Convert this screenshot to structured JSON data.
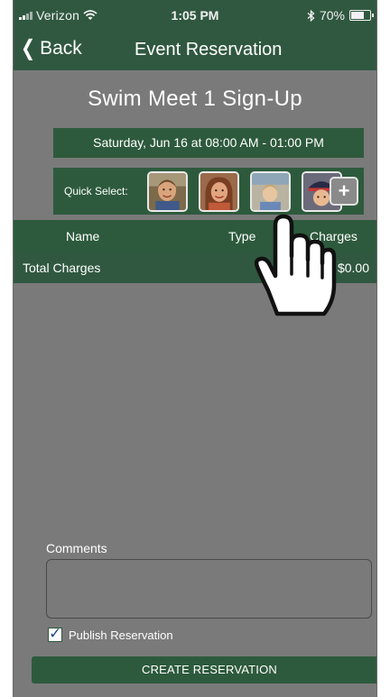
{
  "status_bar": {
    "carrier": "Verizon",
    "time": "1:05 PM",
    "battery_text": "70%",
    "battery_level": 0.7,
    "icons": [
      "signal-icon",
      "wifi-icon",
      "bluetooth-icon",
      "battery-icon"
    ]
  },
  "nav": {
    "back_label": "Back",
    "title": "Event Reservation"
  },
  "event": {
    "title": "Swim Meet 1 Sign-Up",
    "date": "Saturday, Jun 16 at 08:00 AM - 01:00 PM"
  },
  "quick_select": {
    "label": "Quick Select:",
    "add_icon": "plus-icon"
  },
  "table": {
    "columns": [
      "Name",
      "Type",
      "Charges"
    ],
    "total_label": "Total Charges",
    "total_amount": "$0.00"
  },
  "comments": {
    "label": "Comments",
    "value": ""
  },
  "publish": {
    "label": "Publish Reservation",
    "checked": true
  },
  "create_button": "CREATE RESERVATION",
  "colors": {
    "header_green": "#305840",
    "accent_green": "#2d5a3c",
    "background_gray": "#7a7a7a"
  }
}
